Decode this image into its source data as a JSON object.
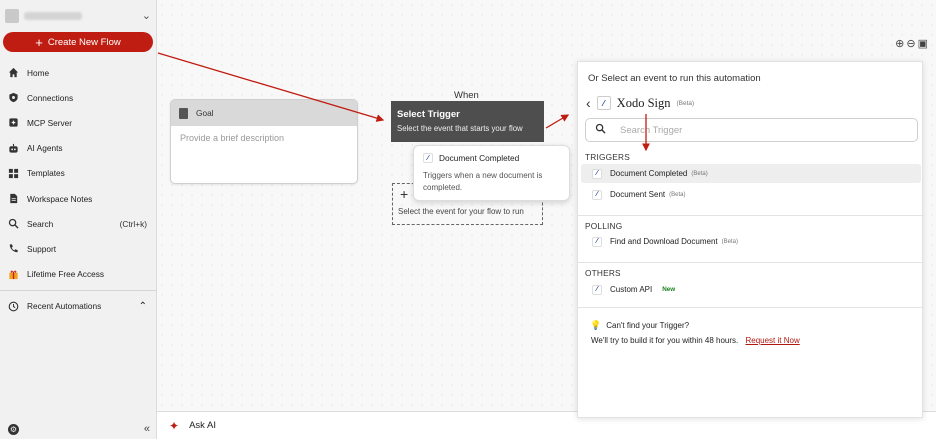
{
  "sidebar": {
    "create_label": "Create New Flow",
    "items": [
      {
        "label": "Home",
        "icon": "home-icon"
      },
      {
        "label": "Connections",
        "icon": "shield-icon"
      },
      {
        "label": "MCP Server",
        "icon": "server-icon"
      },
      {
        "label": "AI Agents",
        "icon": "robot-icon"
      },
      {
        "label": "Templates",
        "icon": "grid-icon"
      },
      {
        "label": "Workspace Notes",
        "icon": "note-icon"
      },
      {
        "label": "Search",
        "icon": "search-icon",
        "shortcut": "(Ctrl+k)"
      },
      {
        "label": "Support",
        "icon": "phone-icon"
      },
      {
        "label": "Lifetime Free Access",
        "icon": "gift-icon"
      }
    ],
    "recent_label": "Recent Automations"
  },
  "canvas": {
    "goal_title": "Goal",
    "goal_placeholder": "Provide a brief description",
    "when_label": "When",
    "trigger_title": "Select Trigger",
    "trigger_subtitle": "Select the event that starts your flow",
    "dashed_text": "Select the event for your flow to run",
    "popup_title": "Document Completed",
    "popup_desc": "Triggers when a new document is completed."
  },
  "askai_label": "Ask AI",
  "panel": {
    "heading": "Or Select an event to run this automation",
    "app_name": "Xodo Sign",
    "app_beta": "(Beta)",
    "search_placeholder": "Search Trigger",
    "sections": {
      "triggers": "TRIGGERS",
      "polling": "POLLING",
      "others": "OTHERS"
    },
    "triggers": [
      {
        "label": "Document Completed",
        "badge": "(Beta)"
      },
      {
        "label": "Document Sent",
        "badge": "(Beta)"
      }
    ],
    "polling": [
      {
        "label": "Find and Download Document",
        "badge": "(Beta)"
      }
    ],
    "others": [
      {
        "label": "Custom API",
        "badge": "New"
      }
    ],
    "cant_find": "Can't find your Trigger?",
    "well_try": "We'll try to build it for you within 48 hours.",
    "request_link": "Request it Now"
  },
  "colors": {
    "brand_red": "#c01d12",
    "trigger_dark": "#4e4e4e"
  }
}
